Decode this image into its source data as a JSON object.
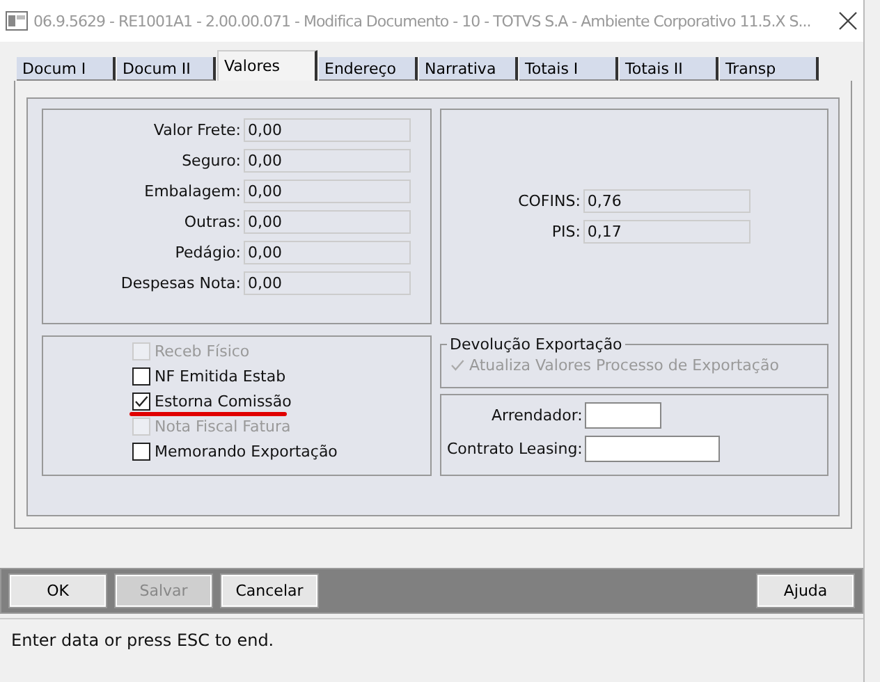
{
  "window": {
    "title": "06.9.5629 - RE1001A1 - 2.00.00.071 - Modifica Documento - 10 - TOTVS S.A - Ambiente Corporativo 11.5.X S..."
  },
  "tabs": [
    {
      "label": "Docum I",
      "selected": false
    },
    {
      "label": "Docum II",
      "selected": false
    },
    {
      "label": "Valores",
      "selected": true
    },
    {
      "label": "Endereço",
      "selected": false
    },
    {
      "label": "Narrativa",
      "selected": false
    },
    {
      "label": "Totais I",
      "selected": false
    },
    {
      "label": "Totais II",
      "selected": false
    },
    {
      "label": "Transp",
      "selected": false
    }
  ],
  "values": [
    {
      "label": "Valor Frete:",
      "value": "0,00"
    },
    {
      "label": "Seguro:",
      "value": "0,00"
    },
    {
      "label": "Embalagem:",
      "value": "0,00"
    },
    {
      "label": "Outras:",
      "value": "0,00"
    },
    {
      "label": "Pedágio:",
      "value": "0,00"
    },
    {
      "label": "Despesas Nota:",
      "value": "0,00"
    }
  ],
  "taxes": [
    {
      "label": "COFINS:",
      "value": "0,76"
    },
    {
      "label": "PIS:",
      "value": "0,17"
    }
  ],
  "options": [
    {
      "label": "Receb Físico",
      "checked": false,
      "disabled": true,
      "underlined": false
    },
    {
      "label": "NF Emitida Estab",
      "checked": false,
      "disabled": false,
      "underlined": false
    },
    {
      "label": "Estorna Comissão",
      "checked": true,
      "disabled": false,
      "underlined": true
    },
    {
      "label": "Nota Fiscal Fatura",
      "checked": false,
      "disabled": true,
      "underlined": false
    },
    {
      "label": "Memorando Exportação",
      "checked": false,
      "disabled": false,
      "underlined": false
    }
  ],
  "devolucao": {
    "legend": "Devolução Exportação",
    "option": {
      "label": "Atualiza Valores Processo de Exportação",
      "checked": true,
      "disabled": true
    }
  },
  "leasing": [
    {
      "label": "Arrendador:"
    },
    {
      "label": "Contrato Leasing:"
    }
  ],
  "buttons": [
    {
      "label": "OK",
      "disabled": false
    },
    {
      "label": "Salvar",
      "disabled": true
    },
    {
      "label": "Cancelar",
      "disabled": false
    },
    {
      "label": "Ajuda",
      "disabled": false
    }
  ],
  "status_bar": "Enter data or press ESC to end."
}
